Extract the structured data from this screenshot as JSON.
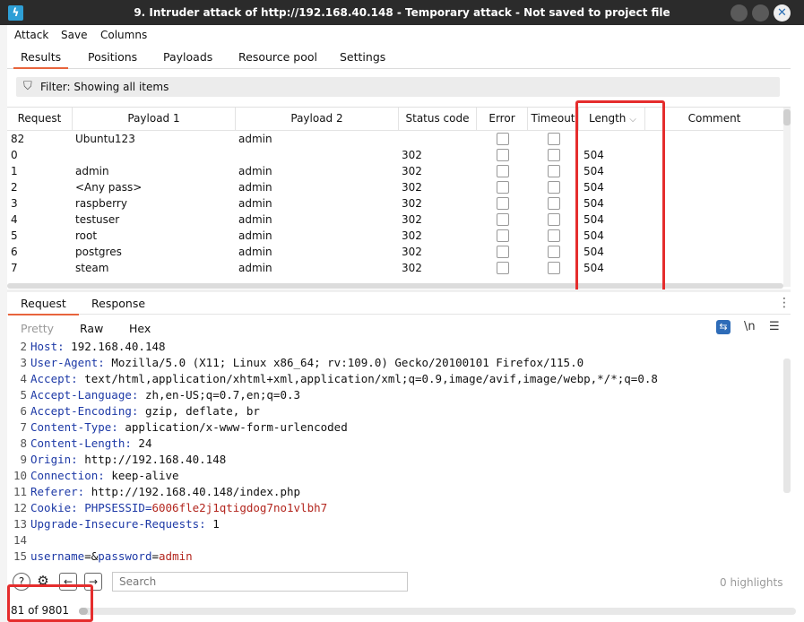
{
  "window": {
    "title": "9. Intruder attack of http://192.168.40.148 - Temporary attack - Not saved to project file",
    "logo_glyph": "ϟ",
    "close_glyph": "✕"
  },
  "menu": [
    "Attack",
    "Save",
    "Columns"
  ],
  "top_tabs": [
    "Results",
    "Positions",
    "Payloads",
    "Resource pool",
    "Settings"
  ],
  "filter": {
    "icon": "filter-icon",
    "text": "Filter: Showing all items"
  },
  "table": {
    "columns": [
      "Request",
      "Payload 1",
      "Payload 2",
      "Status code",
      "Error",
      "Timeout",
      "Length",
      "Comment"
    ],
    "sort_glyph": "⌵",
    "rows": [
      {
        "request": "82",
        "payload1": "Ubuntu123",
        "payload2": "admin",
        "status": "",
        "length": ""
      },
      {
        "request": "0",
        "payload1": "",
        "payload2": "",
        "status": "302",
        "length": "504"
      },
      {
        "request": "1",
        "payload1": "admin",
        "payload2": "admin",
        "status": "302",
        "length": "504"
      },
      {
        "request": "2",
        "payload1": "<Any pass>",
        "payload2": "admin",
        "status": "302",
        "length": "504"
      },
      {
        "request": "3",
        "payload1": "raspberry",
        "payload2": "admin",
        "status": "302",
        "length": "504"
      },
      {
        "request": "4",
        "payload1": "testuser",
        "payload2": "admin",
        "status": "302",
        "length": "504"
      },
      {
        "request": "5",
        "payload1": "root",
        "payload2": "admin",
        "status": "302",
        "length": "504"
      },
      {
        "request": "6",
        "payload1": "postgres",
        "payload2": "admin",
        "status": "302",
        "length": "504"
      },
      {
        "request": "7",
        "payload1": "steam",
        "payload2": "admin",
        "status": "302",
        "length": "504"
      }
    ]
  },
  "req_tabs": [
    "Request",
    "Response"
  ],
  "view_tabs": [
    "Pretty",
    "Raw",
    "Hex"
  ],
  "view_tools": {
    "newline_label": "\\n",
    "menu_glyph": "☰",
    "wrap_glyph": "⇆",
    "kebab_glyph": "⋮"
  },
  "editor": {
    "lines": [
      {
        "n": "2",
        "key": "Host:",
        "val": " 192.168.40.148"
      },
      {
        "n": "3",
        "key": "User-Agent:",
        "val": " Mozilla/5.0 (X11; Linux x86_64; rv:109.0) Gecko/20100101 Firefox/115.0"
      },
      {
        "n": "4",
        "key": "Accept:",
        "val": " text/html,application/xhtml+xml,application/xml;q=0.9,image/avif,image/webp,*/*;q=0.8"
      },
      {
        "n": "5",
        "key": "Accept-Language:",
        "val": " zh,en-US;q=0.7,en;q=0.3"
      },
      {
        "n": "6",
        "key": "Accept-Encoding:",
        "val": " gzip, deflate, br"
      },
      {
        "n": "7",
        "key": "Content-Type:",
        "val": " application/x-www-form-urlencoded"
      },
      {
        "n": "8",
        "key": "Content-Length:",
        "val": " 24"
      },
      {
        "n": "9",
        "key": "Origin:",
        "val": " http://192.168.40.148"
      },
      {
        "n": "10",
        "key": "Connection:",
        "val": " keep-alive"
      },
      {
        "n": "11",
        "key": "Referer:",
        "val": " http://192.168.40.148/index.php"
      },
      {
        "n": "13",
        "key": "Upgrade-Insecure-Requests:",
        "val": " 1"
      },
      {
        "n": "14",
        "key": "",
        "val": ""
      }
    ],
    "cookie": {
      "n": "12",
      "key": "Cookie:",
      "name": " PHPSESSID=",
      "value": "6006fle2j1qtigdog7no1vlbh7"
    },
    "body": {
      "n": "15",
      "user_key": "username",
      "mid": "=&",
      "pw_key": "password",
      "eq": "=",
      "pw_val": "admin"
    }
  },
  "bottom": {
    "help_glyph": "?",
    "settings_glyph": "⚙",
    "back_glyph": "←",
    "forward_glyph": "→",
    "search_placeholder": "Search",
    "highlights": "0 highlights"
  },
  "status": {
    "progress_text": "81 of 9801",
    "progress_fraction": 0.0083
  },
  "colors": {
    "accent_tab": "#e8643c",
    "highlight_box": "#e52d2d",
    "header_key": "#1d39a6",
    "cookie_value": "#b3261e"
  }
}
